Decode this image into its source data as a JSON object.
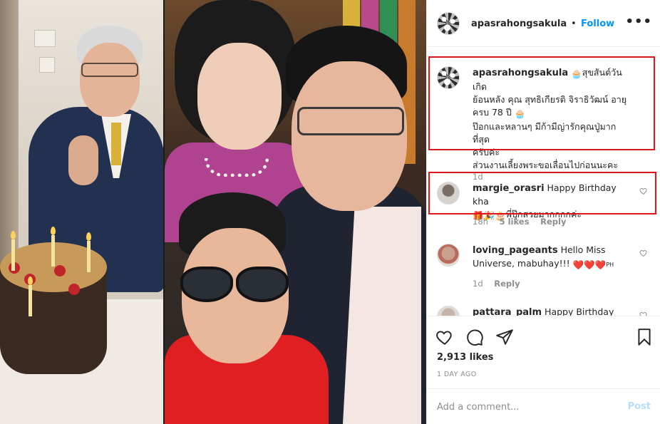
{
  "post": {
    "username": "apasrahongsakula",
    "separator": "•",
    "follow_label": "Follow",
    "more_label": "•••"
  },
  "caption": {
    "username": "apasrahongsakula",
    "emoji_cake": "🧁",
    "line1": "สุขสันต์วันเกิด",
    "line2": "ย้อนหลัง คุณ สุทธิเกียรติ จิราธิวัฒน์ อายุ",
    "line3": "ครบ 78 ปี",
    "line4": "ป๊อกและหลานๆ มีก้ามีญ่ารักคุณปู่มากที่สุด",
    "line5": "ครับค่ะ",
    "line6": "ส่วนงานเลี้ยงพระขอเลื่อนไปก่อนนะคะ",
    "time": "1d"
  },
  "comments": [
    {
      "username": "margie_orasri",
      "text": "Happy Birthday kha",
      "emojis": "🎁🎉🎂",
      "text2": "พี่ปุ๊กสวยมากกกกค่ะ",
      "time": "18h",
      "likes": "5 likes",
      "reply": "Reply"
    },
    {
      "username": "loving_pageants",
      "text": "Hello Miss",
      "text2": "Universe, mabuhay!!!",
      "emojis": "❤️❤️❤️",
      "flag": "PH",
      "time": "1d",
      "reply": "Reply"
    },
    {
      "username": "pattara_palm",
      "text": "Happy Birthday ka..."
    }
  ],
  "likes_text": "2,913 likes",
  "posted_ago": "1 DAY AGO",
  "add_comment": {
    "placeholder": "Add a comment...",
    "post_label": "Post"
  },
  "colors": {
    "accent": "#0095f6",
    "highlight_box": "#e0161b",
    "post_disabled": "#b2dffc"
  }
}
